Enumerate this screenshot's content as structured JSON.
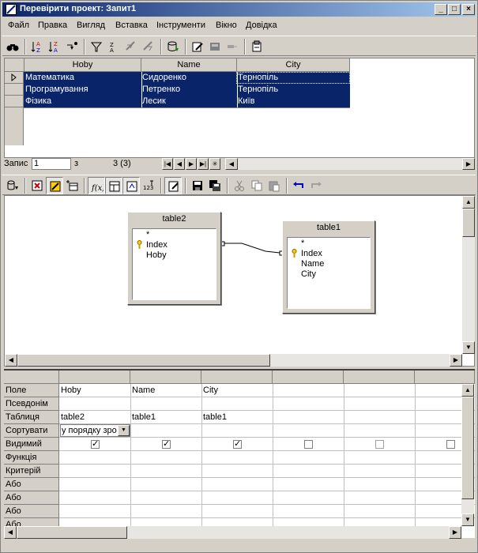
{
  "window": {
    "title": "Перевірити проект: Запит1",
    "controls": [
      "_",
      "□",
      "×"
    ]
  },
  "menu": {
    "items": [
      "Файл",
      "Правка",
      "Вигляд",
      "Вставка",
      "Інструменти",
      "Вікно",
      "Довідка"
    ]
  },
  "results": {
    "columns": [
      "Hoby",
      "Name",
      "City"
    ],
    "rows": [
      [
        "Математика",
        "Сидоренко",
        "Тернопіль"
      ],
      [
        "Програмування",
        "Петренко",
        "Тернопіль"
      ],
      [
        "Фізика",
        "Лесик",
        "Київ"
      ]
    ]
  },
  "record_nav": {
    "label": "Запис",
    "current": "1",
    "of_label": "з",
    "total": "3 (3)"
  },
  "diagram": {
    "tables": [
      {
        "name": "table2",
        "fields": [
          "*",
          "Index",
          "Hoby"
        ]
      },
      {
        "name": "table1",
        "fields": [
          "*",
          "Index",
          "Name",
          "City"
        ]
      }
    ]
  },
  "query_grid": {
    "row_labels": [
      "Поле",
      "Псевдонім",
      "Таблиця",
      "Сортувати",
      "Видимий",
      "Функція",
      "Критерій",
      "Або",
      "Або",
      "Або",
      "Або"
    ],
    "columns": [
      {
        "field": "Hoby",
        "table": "table2",
        "sort": "у порядку зро",
        "visible": true
      },
      {
        "field": "Name",
        "table": "table1",
        "sort": "",
        "visible": true
      },
      {
        "field": "City",
        "table": "table1",
        "sort": "",
        "visible": true
      },
      {
        "field": "",
        "table": "",
        "sort": "",
        "visible": false
      },
      {
        "field": "",
        "table": "",
        "sort": "",
        "visible": false
      },
      {
        "field": "",
        "table": "",
        "sort": "",
        "visible": false
      }
    ]
  },
  "colors": {
    "title_start": "#0a246a",
    "title_end": "#a6caf0",
    "selection": "#0a246a",
    "face": "#d4d0c8"
  }
}
